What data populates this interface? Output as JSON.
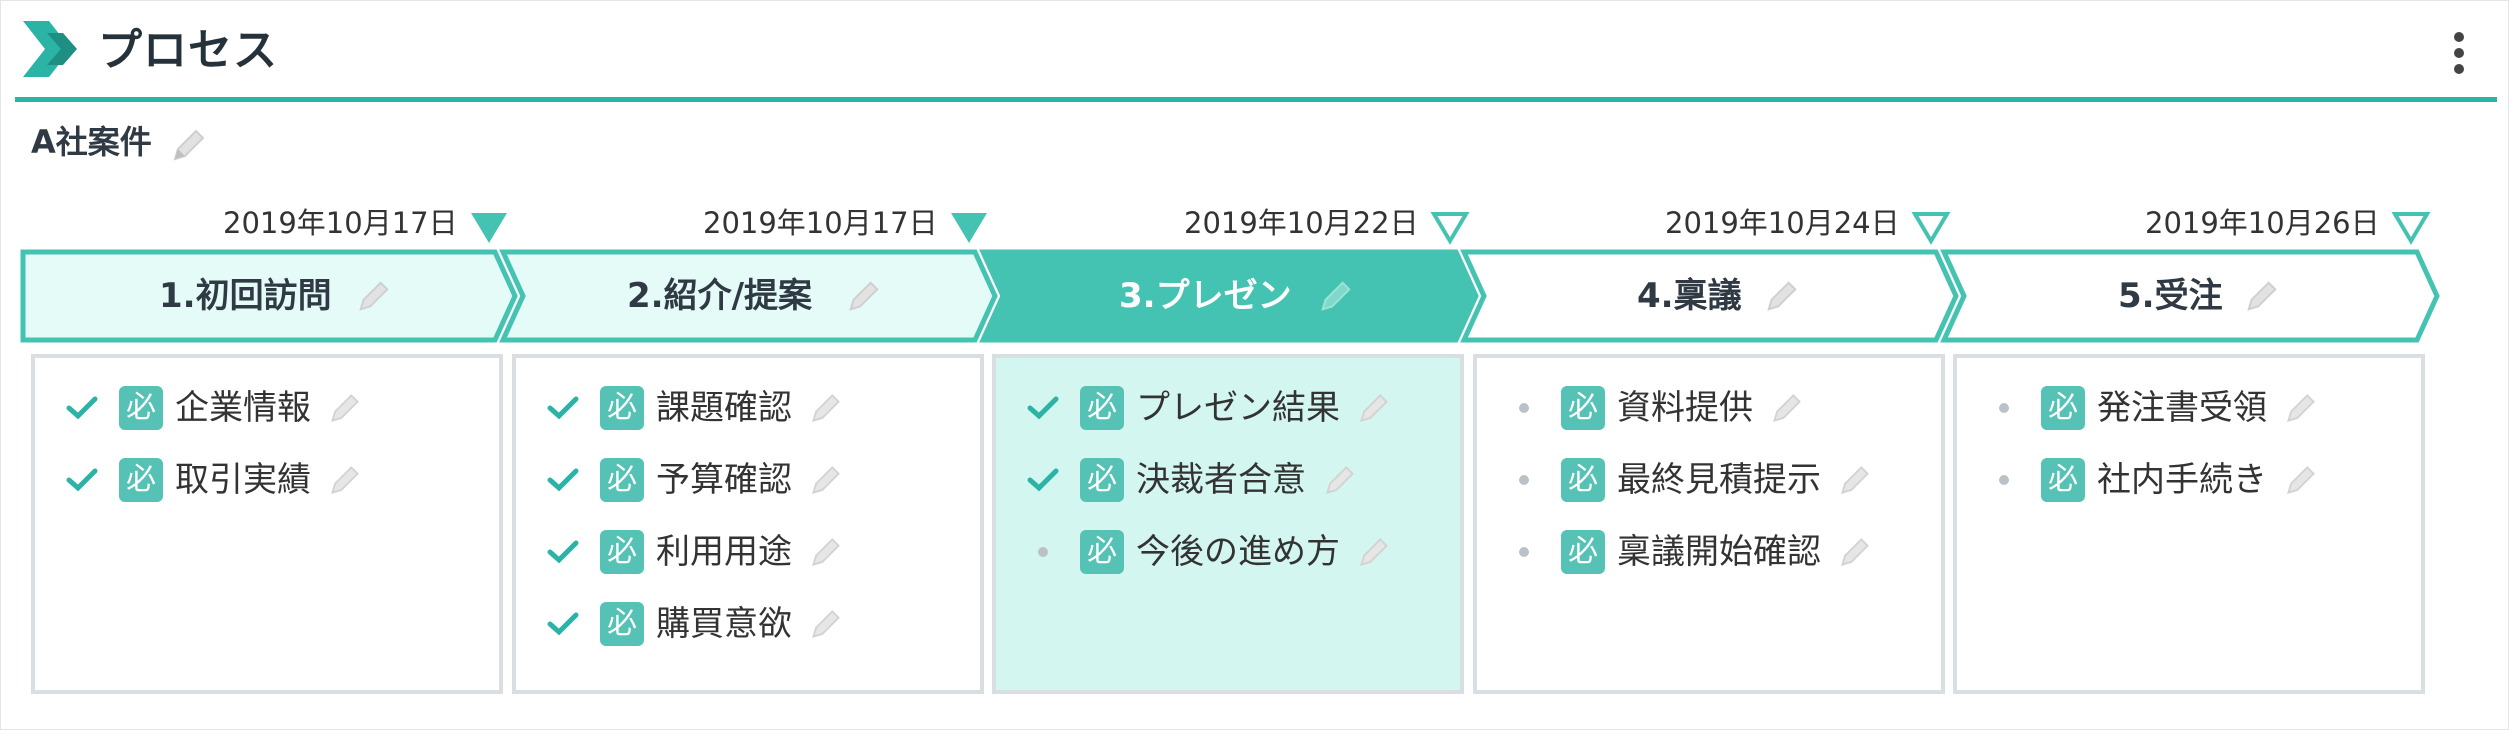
{
  "header": {
    "title": "プロセス",
    "menu_icon": "more-vertical-icon",
    "accent": "#2bb3a5"
  },
  "case": {
    "title": "A社案件"
  },
  "stages": [
    {
      "label": "1.初回訪問",
      "date": "2019年10月17日",
      "state": "done",
      "tasks": [
        {
          "label": "企業情報",
          "status": "done",
          "badge": "必"
        },
        {
          "label": "取引実績",
          "status": "done",
          "badge": "必"
        }
      ]
    },
    {
      "label": "2.紹介/提案",
      "date": "2019年10月17日",
      "state": "done",
      "tasks": [
        {
          "label": "課題確認",
          "status": "done",
          "badge": "必"
        },
        {
          "label": "予算確認",
          "status": "done",
          "badge": "必"
        },
        {
          "label": "利用用途",
          "status": "done",
          "badge": "必"
        },
        {
          "label": "購買意欲",
          "status": "done",
          "badge": "必"
        }
      ]
    },
    {
      "label": "3.プレゼン",
      "date": "2019年10月22日",
      "state": "current",
      "tasks": [
        {
          "label": "プレゼン結果",
          "status": "done",
          "badge": "必"
        },
        {
          "label": "決裁者合意",
          "status": "done",
          "badge": "必"
        },
        {
          "label": "今後の進め方",
          "status": "pending",
          "badge": "必"
        }
      ]
    },
    {
      "label": "4.稟議",
      "date": "2019年10月24日",
      "state": "upcoming",
      "tasks": [
        {
          "label": "資料提供",
          "status": "pending",
          "badge": "必"
        },
        {
          "label": "最終見積提示",
          "status": "pending",
          "badge": "必"
        },
        {
          "label": "稟議開始確認",
          "status": "pending",
          "badge": "必"
        }
      ]
    },
    {
      "label": "5.受注",
      "date": "2019年10月26日",
      "state": "upcoming",
      "tasks": [
        {
          "label": "発注書受領",
          "status": "pending",
          "badge": "必"
        },
        {
          "label": "社内手続き",
          "status": "pending",
          "badge": "必"
        }
      ]
    }
  ],
  "colors": {
    "teal": "#2bb3a5",
    "teal_dark": "#45c3b2",
    "light_fill": "#e4fbf7",
    "current_bg": "#d3f6f0",
    "badge": "#55c2b5"
  }
}
